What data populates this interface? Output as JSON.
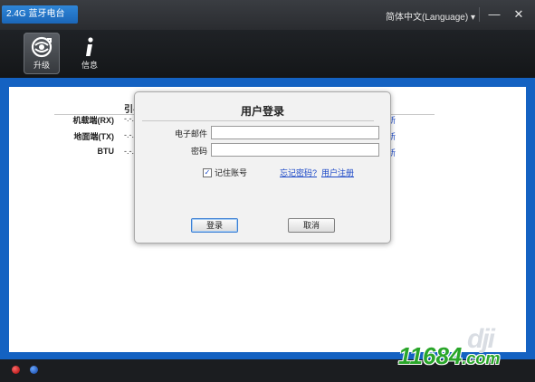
{
  "app": {
    "title": "2.4G 蓝牙电台"
  },
  "titlebar": {
    "language_label": "简体中文(Language)",
    "minimize_label": "—",
    "close_label": "✕"
  },
  "toolbar": {
    "items": [
      {
        "label": "升级",
        "icon": "upgrade-globe-icon",
        "active": true
      },
      {
        "label": "信息",
        "icon": "info-icon",
        "active": false
      }
    ]
  },
  "device_table": {
    "column_head": "引导",
    "rows": [
      {
        "label": "机载端(RX)",
        "value": "-.-.",
        "link": "新"
      },
      {
        "label": "地面端(TX)",
        "value": "-.-.",
        "link": "新"
      },
      {
        "label": "BTU",
        "value": "-.-.",
        "link": "新"
      }
    ]
  },
  "login_dialog": {
    "title": "用户登录",
    "email_label": "电子邮件",
    "email_value": "",
    "password_label": "密码",
    "password_value": "",
    "remember_label": "记住账号",
    "remember_checked": true,
    "forgot_label": "忘记密码?",
    "register_label": "用户注册",
    "login_button": "登录",
    "cancel_button": "取消"
  },
  "watermark": {
    "logo_text": "dji",
    "site_text": "11684",
    "site_tld": ".com"
  },
  "colors": {
    "content_frame": "#1462c2",
    "app_tab": "#1b66b8",
    "link": "#1a47c7",
    "site_watermark": "#2aa62a"
  }
}
